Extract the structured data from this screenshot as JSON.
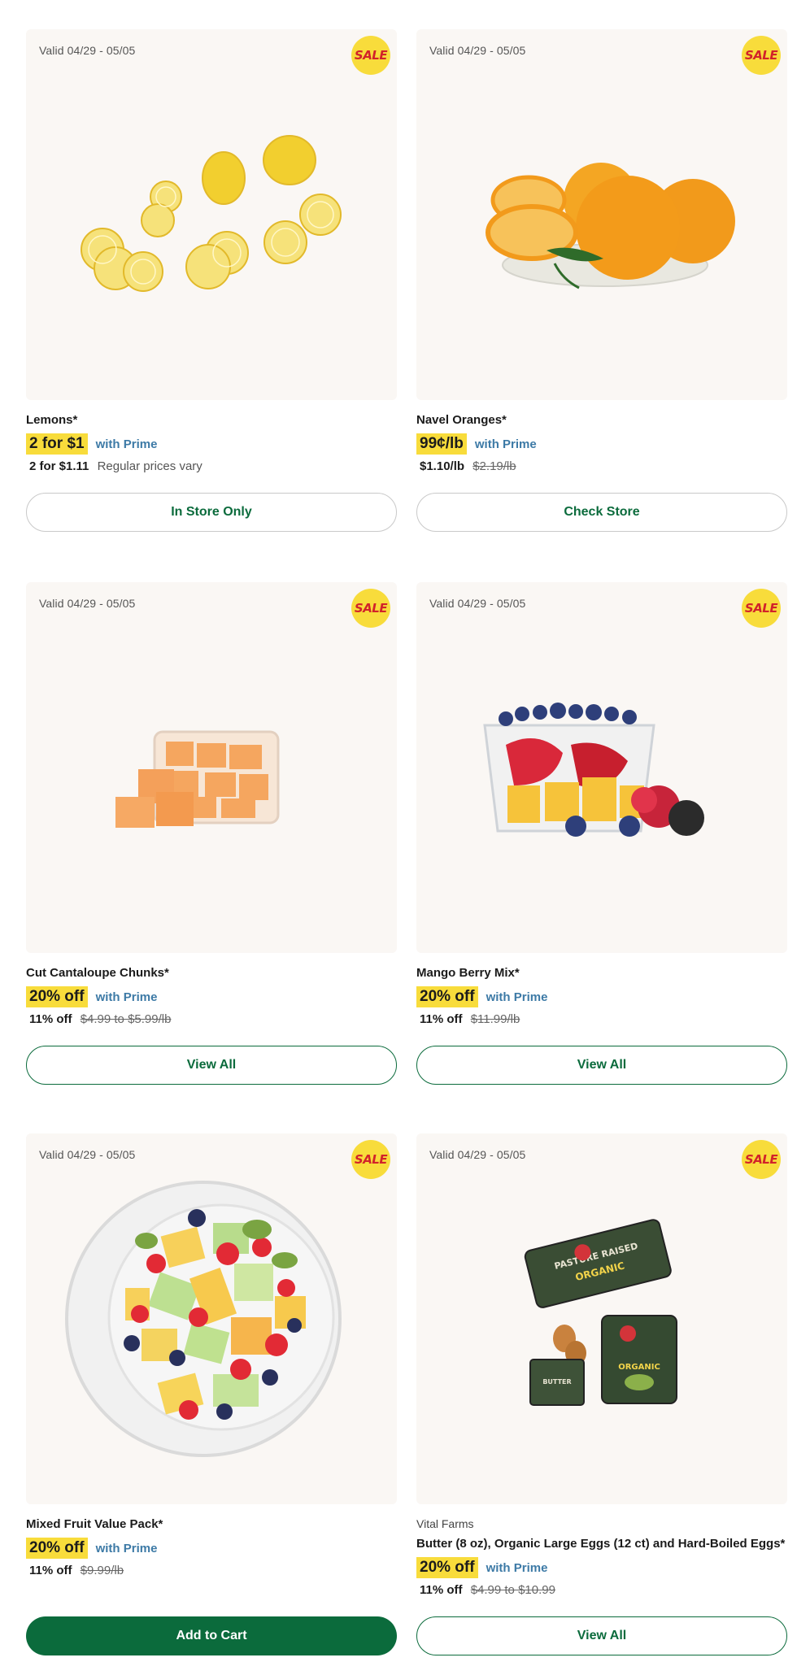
{
  "products": [
    {
      "valid": "Valid 04/29 - 05/05",
      "badge": "SALE",
      "brand": "",
      "name": "Lemons*",
      "deal": "2 for $1",
      "prime": "with Prime",
      "regular_bold": "2 for $1.11",
      "regular_strike": "",
      "regular_note": "Regular prices vary",
      "button": "In Store Only",
      "button_style": "outline-grey",
      "image": "lemons"
    },
    {
      "valid": "Valid 04/29 - 05/05",
      "badge": "SALE",
      "brand": "",
      "name": "Navel Oranges*",
      "deal": "99¢/lb",
      "prime": "with Prime",
      "regular_bold": "$1.10/lb",
      "regular_strike": "$2.19/lb",
      "regular_note": "",
      "button": "Check Store",
      "button_style": "outline-grey",
      "image": "oranges"
    },
    {
      "valid": "Valid 04/29 - 05/05",
      "badge": "SALE",
      "brand": "",
      "name": "Cut Cantaloupe Chunks*",
      "deal": "20% off",
      "prime": "with Prime",
      "regular_bold": "11% off",
      "regular_strike": "$4.99 to $5.99/lb",
      "regular_note": "",
      "button": "View All",
      "button_style": "outline-green",
      "image": "cantaloupe"
    },
    {
      "valid": "Valid 04/29 - 05/05",
      "badge": "SALE",
      "brand": "",
      "name": "Mango Berry Mix*",
      "deal": "20% off",
      "prime": "with Prime",
      "regular_bold": "11% off",
      "regular_strike": "$11.99/lb",
      "regular_note": "",
      "button": "View All",
      "button_style": "outline-green",
      "image": "mango-berry"
    },
    {
      "valid": "Valid 04/29 - 05/05",
      "badge": "SALE",
      "brand": "",
      "name": "Mixed Fruit Value Pack*",
      "deal": "20% off",
      "prime": "with Prime",
      "regular_bold": "11% off",
      "regular_strike": "$9.99/lb",
      "regular_note": "",
      "button": "Add to Cart",
      "button_style": "filled",
      "image": "mixed-fruit"
    },
    {
      "valid": "Valid 04/29 - 05/05",
      "badge": "SALE",
      "brand": "Vital Farms",
      "name": "Butter (8 oz), Organic Large Eggs (12 ct) and Hard-Boiled Eggs*",
      "deal": "20% off",
      "prime": "with Prime",
      "regular_bold": "11% off",
      "regular_strike": "$4.99 to $10.99",
      "regular_note": "",
      "button": "View All",
      "button_style": "outline-green",
      "image": "vital-farms"
    }
  ],
  "art_labels": {
    "egg_carton": "PASTURE RAISED",
    "egg_carton_sub": "ORGANIC",
    "butter_box": "BUTTER",
    "hard_boiled": "ORGANIC"
  },
  "colors": {
    "accent_green": "#0b6b3c",
    "deal_yellow": "#f8dc3b",
    "prime_blue": "#3d7aa6",
    "sale_red": "#d2232a"
  }
}
